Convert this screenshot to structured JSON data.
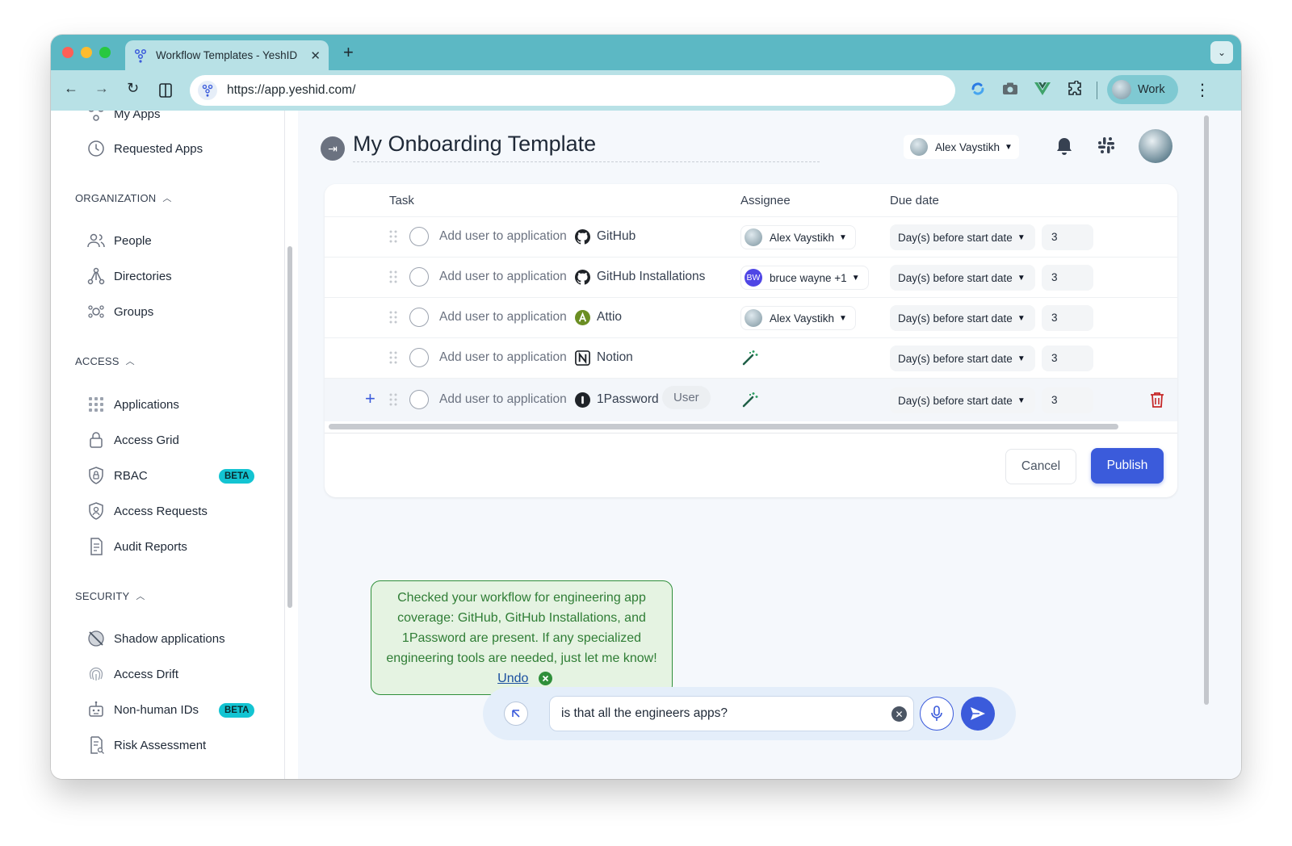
{
  "browser": {
    "tab_title": "Workflow Templates - YeshID",
    "url": "https://app.yeshid.com/",
    "profile_label": "Work"
  },
  "sidebar": {
    "partial_item": "My Apps",
    "requested_apps": "Requested Apps",
    "organization": {
      "heading": "ORGANIZATION",
      "items": [
        "People",
        "Directories",
        "Groups"
      ]
    },
    "access": {
      "heading": "ACCESS",
      "items": [
        "Applications",
        "Access Grid",
        "RBAC",
        "Access Requests",
        "Audit Reports"
      ],
      "rbac_badge": "BETA"
    },
    "security": {
      "heading": "SECURITY",
      "items": [
        "Shadow applications",
        "Access Drift",
        "Non-human IDs",
        "Risk Assessment"
      ],
      "nonhuman_badge": "BETA"
    }
  },
  "header": {
    "title": "My Onboarding Template",
    "owner": "Alex Vaystikh"
  },
  "table": {
    "columns": {
      "task": "Task",
      "assignee": "Assignee",
      "due": "Due date"
    },
    "rows": [
      {
        "task": "Add user to application",
        "app": "GitHub",
        "assignee": "Alex Vaystikh",
        "due": "Day(s) before start date",
        "days": "3"
      },
      {
        "task": "Add user to application",
        "app": "GitHub Installations",
        "assignee": "bruce wayne +1",
        "assignee_initials": "BW",
        "due": "Day(s) before start date",
        "days": "3"
      },
      {
        "task": "Add user to application",
        "app": "Attio",
        "assignee": "Alex Vaystikh",
        "due": "Day(s) before start date",
        "days": "3"
      },
      {
        "task": "Add user to application",
        "app": "Notion",
        "assignee": "",
        "due": "Day(s) before start date",
        "days": "3"
      },
      {
        "task": "Add user to application",
        "app": "1Password",
        "role": "User",
        "assignee": "",
        "due": "Day(s) before start date",
        "days": "3"
      }
    ]
  },
  "actions": {
    "cancel": "Cancel",
    "publish": "Publish"
  },
  "assistant": {
    "message": "Checked your workflow for engineering app coverage: GitHub, GitHub Installations, and 1Password are present. If any specialized engineering tools are needed, just let me know!",
    "undo": "Undo",
    "input_value": "is that all the engineers apps?"
  },
  "colors": {
    "accent": "#3b5bdb",
    "chrome": "#5cb8c4",
    "beta_badge": "#13c4d2",
    "assistant_green": "#2f8f3a",
    "danger": "#c62828"
  }
}
